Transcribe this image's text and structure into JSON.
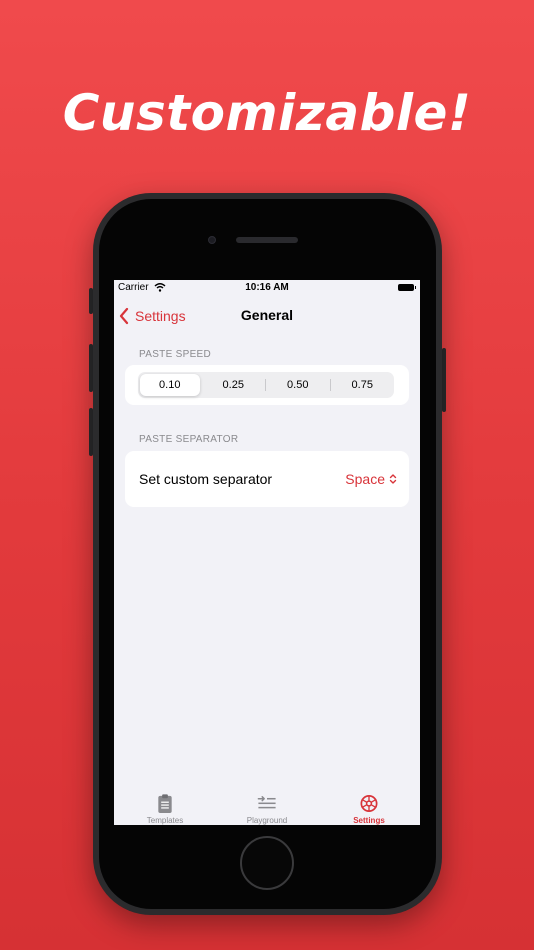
{
  "headline": "Customizable!",
  "status_bar": {
    "carrier": "Carrier",
    "time": "10:16 AM"
  },
  "nav": {
    "back_label": "Settings",
    "title": "General"
  },
  "paste_speed": {
    "header": "PASTE SPEED",
    "options": [
      "0.10",
      "0.25",
      "0.50",
      "0.75"
    ],
    "selected": "0.10"
  },
  "paste_separator": {
    "header": "PASTE SEPARATOR",
    "row_label": "Set custom separator",
    "value": "Space"
  },
  "tabs": [
    {
      "label": "Templates",
      "icon": "clipboard-icon"
    },
    {
      "label": "Playground",
      "icon": "playground-icon"
    },
    {
      "label": "Settings",
      "icon": "gear-icon",
      "active": true
    }
  ],
  "colors": {
    "background": "#e23a3c",
    "accent": "#d8343a"
  }
}
